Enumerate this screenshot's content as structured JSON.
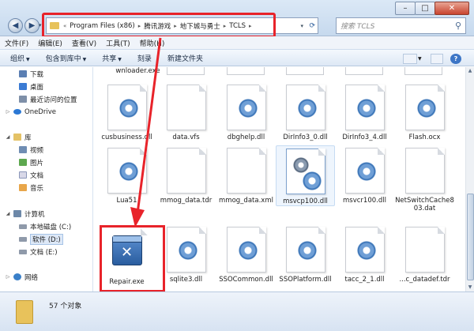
{
  "window": {
    "controls": {
      "minimize": "–",
      "maximize": "□",
      "close": "✕"
    }
  },
  "address": {
    "breadcrumbs": [
      "Program Files (x86)",
      "腾讯游戏",
      "地下城与勇士",
      "TCLS"
    ],
    "overflow": "«",
    "sep": "▸"
  },
  "search": {
    "placeholder": "搜索 TCLS"
  },
  "menu": [
    "文件(F)",
    "编辑(E)",
    "查看(V)",
    "工具(T)",
    "帮助(H)"
  ],
  "toolbar": {
    "organize": "组织",
    "include_in_library": "包含到库中",
    "share": "共享",
    "burn": "刻录",
    "new_folder": "新建文件夹",
    "help": "?"
  },
  "sidebar": {
    "favorites": [
      {
        "label": "下载",
        "icon": "download-icon"
      },
      {
        "label": "桌面",
        "icon": "desktop-icon"
      },
      {
        "label": "最近访问的位置",
        "icon": "recent-places-icon"
      }
    ],
    "onedrive": "OneDrive",
    "libraries": {
      "label": "库",
      "items": [
        {
          "label": "视频",
          "icon": "video-icon"
        },
        {
          "label": "图片",
          "icon": "pictures-icon"
        },
        {
          "label": "文档",
          "icon": "documents-icon"
        },
        {
          "label": "音乐",
          "icon": "music-icon"
        }
      ]
    },
    "computer": {
      "label": "计算机",
      "items": [
        {
          "label": "本地磁盘 (C:)"
        },
        {
          "label": "软件 (D:)"
        },
        {
          "label": "文档 (E:)"
        }
      ]
    },
    "network": "网络"
  },
  "files": {
    "row0": [
      "wnloader.exe"
    ],
    "row1": [
      "cusbusiness.dll",
      "data.vfs",
      "dbghelp.dll",
      "DirInfo3_0.dll",
      "DirInfo3_4.dll",
      "Flash.ocx"
    ],
    "row2": [
      "Lua51",
      "mmog_data.tdr",
      "mmog_data.xml",
      "msvcp100.dll",
      "msvcr100.dll",
      "NetSwitchCache803.dat"
    ],
    "row3": [
      "Repair.exe",
      "sqlite3.dll",
      "SSOCommon.dll",
      "SSOPlatform.dll",
      "tacc_2_1.dll",
      "...c_datadef.tdr"
    ]
  },
  "status": {
    "count": "57 个对象"
  },
  "colors": {
    "highlight": "#e8232a",
    "folder": "#e7c25a",
    "accent": "#3e77b9"
  }
}
